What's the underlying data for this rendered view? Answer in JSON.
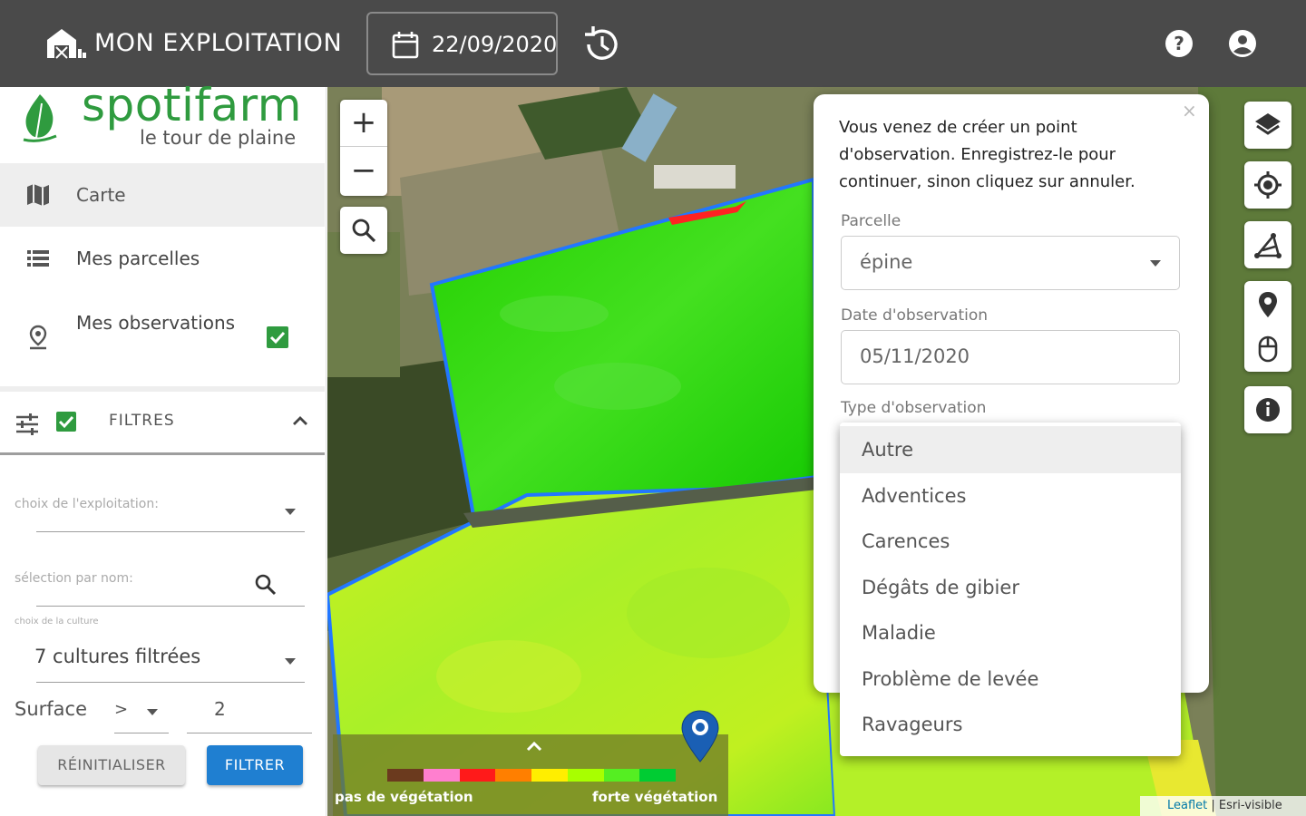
{
  "topbar": {
    "title": "MON EXPLOITATION",
    "date": "22/09/2020"
  },
  "logo": {
    "name": "spotifarm",
    "subtitle": "le tour de plaine"
  },
  "nav": {
    "carte": "Carte",
    "parcelles": "Mes parcelles",
    "observations": "Mes observations",
    "observations_checked": true
  },
  "filters": {
    "title": "FILTRES",
    "enabled": true,
    "exploitation_label": "choix de l'exploitation:",
    "name_label": "sélection par nom:",
    "culture_label": "choix de la culture",
    "culture_value": "7 cultures filtrées",
    "surface_label": "Surface",
    "surface_operator": ">",
    "surface_value": "2",
    "reset_button": "RÉINITIALISER",
    "filter_button": "FILTRER"
  },
  "map": {
    "zoom_in": "+",
    "zoom_out": "−",
    "legend": {
      "low_label": "pas de végétation",
      "high_label": "forte végétation",
      "colors": [
        "#6b3a1e",
        "#ff7fcf",
        "#ff1a1a",
        "#ff7f00",
        "#ffee00",
        "#a8ff00",
        "#55ee22",
        "#00cc33"
      ]
    },
    "attribution_link": "Leaflet",
    "attribution_text": " | Esri-visible"
  },
  "popup": {
    "message": "Vous venez de créer un point d'observation. Enregistrez-le pour continuer, sinon cliquez sur annuler.",
    "close": "×",
    "parcelle_label": "Parcelle",
    "parcelle_value": "épine",
    "date_label": "Date d'observation",
    "date_value": "05/11/2020",
    "type_label": "Type d'observation",
    "type_options": [
      "Autre",
      "Adventices",
      "Carences",
      "Dégâts de gibier",
      "Maladie",
      "Problème de levée",
      "Ravageurs"
    ],
    "type_selected": "Autre"
  },
  "colors": {
    "topbar": "#4a4a4a",
    "brand_green": "#2f9b3f",
    "filter_button": "#1f7fd1",
    "parcel_border": "#2277ff"
  }
}
